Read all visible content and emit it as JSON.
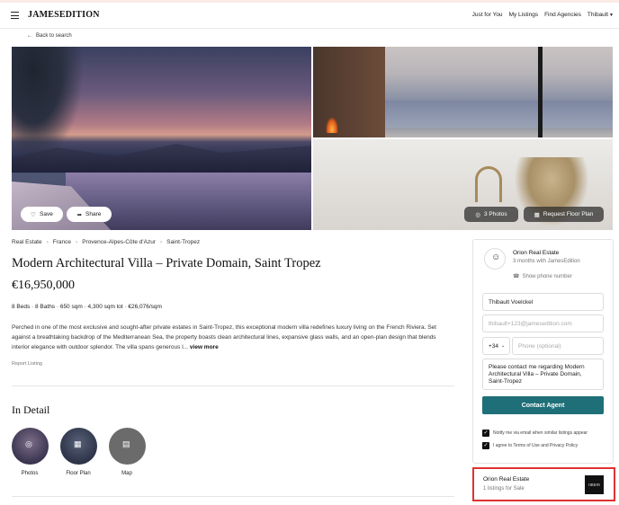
{
  "header": {
    "logo": "JAMESEDITION",
    "nav": [
      "Just for You",
      "My Listings",
      "Find Agencies",
      "Thibault"
    ]
  },
  "back_link": "Back to search",
  "gallery": {
    "save": "Save",
    "share": "Share",
    "photos": "3 Photos",
    "floor_plan": "Request Floor Plan"
  },
  "breadcrumbs": [
    "Real Estate",
    "France",
    "Provence-Alpes-Côte d'Azur",
    "Saint-Tropez"
  ],
  "listing": {
    "title": "Modern Architectural Villa – Private Domain, Saint Tropez",
    "price": "€16,950,000",
    "facts": "8 Beds · 8 Baths · 650 sqm · 4,300 sqm lot · €26,076/sqm",
    "description": "Perched in one of the most exclusive and sought-after private estates in Saint-Tropez, this exceptional modern villa redefines luxury living on the French Riviera. Set against a breathtaking backdrop of the Mediterranean Sea, the property boasts clean architectural lines, expansive glass walls, and an open-plan design that blends interior elegance with outdoor splendor. The villa spans generous l...",
    "view_more": "view more",
    "report": "Report Listing"
  },
  "in_detail": {
    "heading": "In Detail",
    "items": [
      "Photos",
      "Floor Plan",
      "Map"
    ]
  },
  "agent": {
    "name": "Orion Real Estate",
    "tenure": "3 months with JamesEdition",
    "show_phone": "Show phone number"
  },
  "form": {
    "name_value": "Thibault Voelckel",
    "email_placeholder": "thibault+123@jamesedition.com",
    "country_code": "+34",
    "phone_placeholder": "Phone (optional)",
    "message": "Please contact me regarding Modern Architectural Villa – Private Domain, Saint-Tropez",
    "submit": "Contact Agent",
    "notify": "Notify me via email when similar listings appear",
    "terms": "I agree to Terms of Use and Privacy Policy"
  },
  "agency": {
    "name": "Orion Real Estate",
    "listings": "1 listings for Sale",
    "logo_text": "ORION"
  },
  "colors": {
    "accent": "#1e6f78",
    "highlight": "#e03131"
  }
}
